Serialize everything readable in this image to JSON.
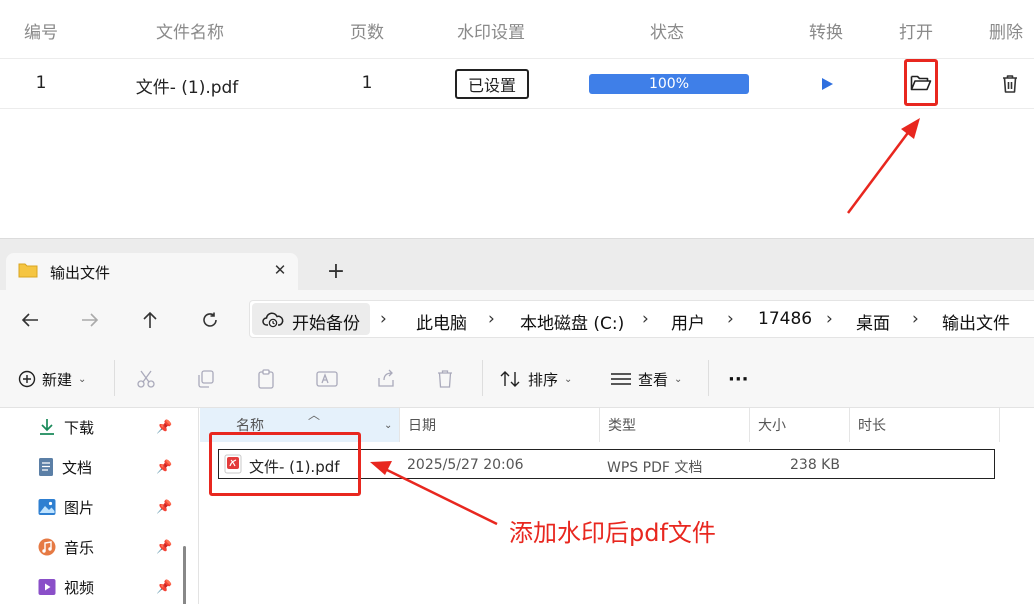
{
  "task_table": {
    "headers": [
      "编号",
      "文件名称",
      "页数",
      "水印设置",
      "状态",
      "转换",
      "打开",
      "删除"
    ],
    "row": {
      "index": "1",
      "filename": "文件- (1).pdf",
      "pages": "1",
      "watermark_badge": "已设置",
      "progress_label": "100%",
      "progress_value": 1.0
    }
  },
  "explorer": {
    "tab_title": "输出文件",
    "tab_close": "✕",
    "tab_new": "+",
    "backup_label": "开始备份",
    "breadcrumbs": [
      "此电脑",
      "本地磁盘 (C:)",
      "用户",
      "17486",
      "桌面",
      "输出文件"
    ],
    "separator": "›",
    "toolbar": {
      "new_label": "新建",
      "sort_label": "排序",
      "view_label": "查看",
      "more_label": "···"
    },
    "sidebar": [
      {
        "label": "下载",
        "icon": "download-icon"
      },
      {
        "label": "文档",
        "icon": "document-icon"
      },
      {
        "label": "图片",
        "icon": "pictures-icon"
      },
      {
        "label": "音乐",
        "icon": "music-icon"
      },
      {
        "label": "视频",
        "icon": "video-icon"
      }
    ],
    "columns": [
      "名称",
      "日期",
      "类型",
      "大小",
      "时长"
    ],
    "file": {
      "name": "文件- (1).pdf",
      "date": "2025/5/27 20:06",
      "type": "WPS PDF 文档",
      "size": "238 KB",
      "duration": ""
    }
  },
  "annotation": {
    "text": "添加水印后pdf文件",
    "color": "#e8271f"
  },
  "colors": {
    "progress": "#3f7fe8",
    "highlight": "#e8271f",
    "folder": "#f5c542"
  }
}
